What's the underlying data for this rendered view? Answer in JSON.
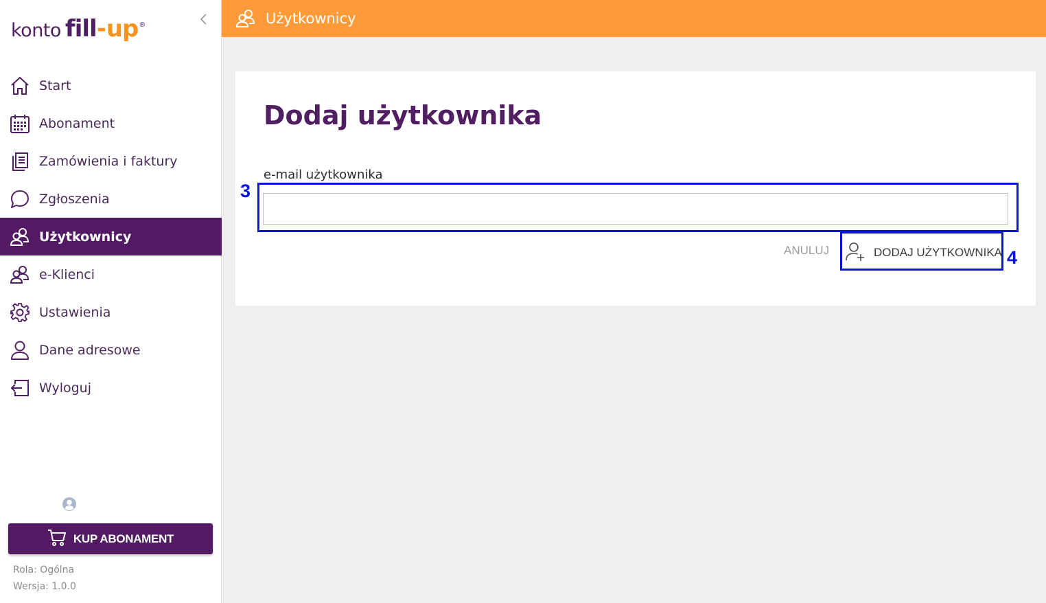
{
  "brand": {
    "logo_konto": "konto",
    "logo_fill": "fill",
    "logo_dash": "-",
    "logo_up": "up",
    "logo_reg": "®",
    "primary_color": "#531a64",
    "accent_color": "#fd9b38"
  },
  "sidebar": {
    "collapse_icon": "chevron-left-icon",
    "items": [
      {
        "label": "Start",
        "icon": "home-icon",
        "active": false
      },
      {
        "label": "Abonament",
        "icon": "calendar-icon",
        "active": false
      },
      {
        "label": "Zamówienia i faktury",
        "icon": "documents-icon",
        "active": false
      },
      {
        "label": "Zgłoszenia",
        "icon": "chat-bubble-icon",
        "active": false
      },
      {
        "label": "Użytkownicy",
        "icon": "users-icon",
        "active": true
      },
      {
        "label": "e-Klienci",
        "icon": "clients-icon",
        "active": false
      },
      {
        "label": "Ustawienia",
        "icon": "gear-icon",
        "active": false
      },
      {
        "label": "Dane adresowe",
        "icon": "person-icon",
        "active": false
      },
      {
        "label": "Wyloguj",
        "icon": "logout-icon",
        "active": false
      }
    ],
    "buy_button": "KUP ABONAMENT",
    "role": "Rola: Ogólna",
    "version": "Wersja: 1.0.0"
  },
  "header": {
    "title": "Użytkownicy",
    "icon": "users-icon"
  },
  "form": {
    "title": "Dodaj użytkownika",
    "email_label": "e-mail użytkownika",
    "email_value": "",
    "email_placeholder": "",
    "cancel_label": "ANULUJ",
    "submit_label": "DODAJ UŻYTKOWNIKA",
    "submit_icon": "add-user-icon"
  },
  "annotations": {
    "input_marker": "3",
    "button_marker": "4",
    "color": "#0a14d6"
  }
}
